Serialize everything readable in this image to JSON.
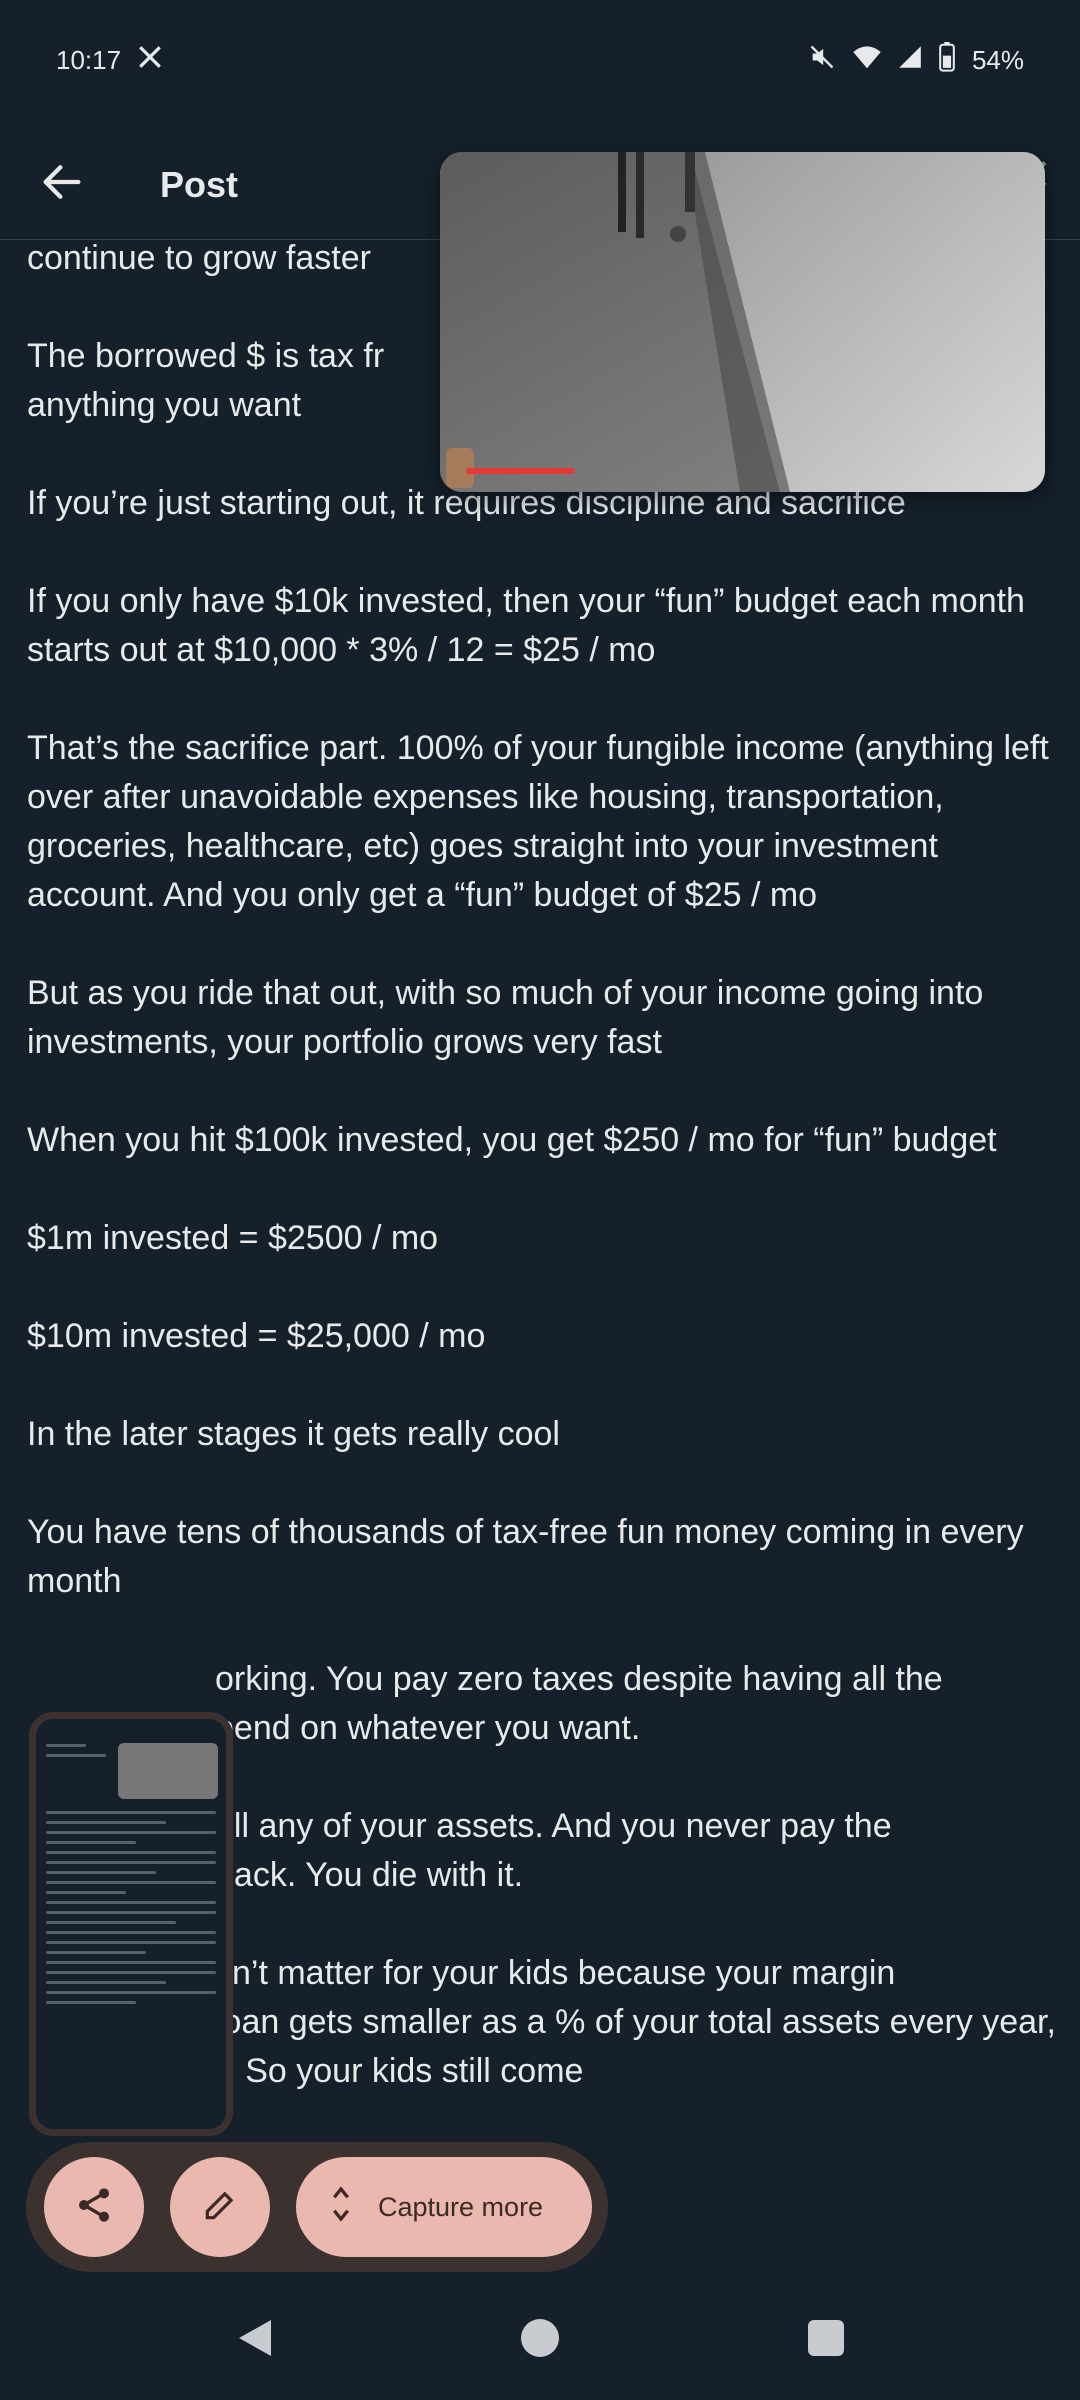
{
  "status_bar": {
    "time": "10:17",
    "battery": "54%",
    "icons": [
      "x-logo-icon",
      "mute-icon",
      "wifi-icon",
      "signal-icon",
      "battery-icon"
    ]
  },
  "header": {
    "title": "Post",
    "back_icon": "arrow-left-icon"
  },
  "post": {
    "paragraphs": [
      "continue to grow faster",
      "The borrowed $ is tax fr\nanything you want",
      "If you’re just starting out, it requires discipline and sacrifice",
      "If you only have $10k invested, then your “fun” budget each month starts out at $10,000 * 3% / 12  = $25 / mo",
      "That’s the sacrifice part. 100% of your fungible income (anything left over after unavoidable expenses like housing, transportation, groceries, healthcare, etc) goes straight into your investment account. And you only get a “fun” budget of $25 / mo",
      "But as you ride that out, with so much of your income going into investments, your portfolio grows very fast",
      "When you hit $100k invested, you get $250 / mo for “fun” budget",
      "$1m invested = $2500 / mo",
      "$10m invested = $25,000 / mo",
      "In the later stages it gets really cool",
      "You have tens of thousands of tax-free fun money coming in every month",
      "orking. You pay zero taxes despite having all the\npend on whatever you want.",
      "ell any of your assets. And you never pay the\nback. You die with it.",
      "sn’t matter for your kids because your margin\nloan gets smaller as a % of your total assets every year,\n). So your kids still come"
    ]
  },
  "video_pip": {
    "progress": 0.18,
    "progress_color": "#e53935"
  },
  "capture_toolbar": {
    "share_icon": "share-icon",
    "edit_icon": "pencil-icon",
    "capture_more_label": "Capture more",
    "expand_icon": "unfold-icon"
  },
  "colors": {
    "background": "#15202b",
    "text": "#e7e9ea",
    "toolbar_bg": "#3b322f",
    "button_bg": "#eab8ae"
  }
}
